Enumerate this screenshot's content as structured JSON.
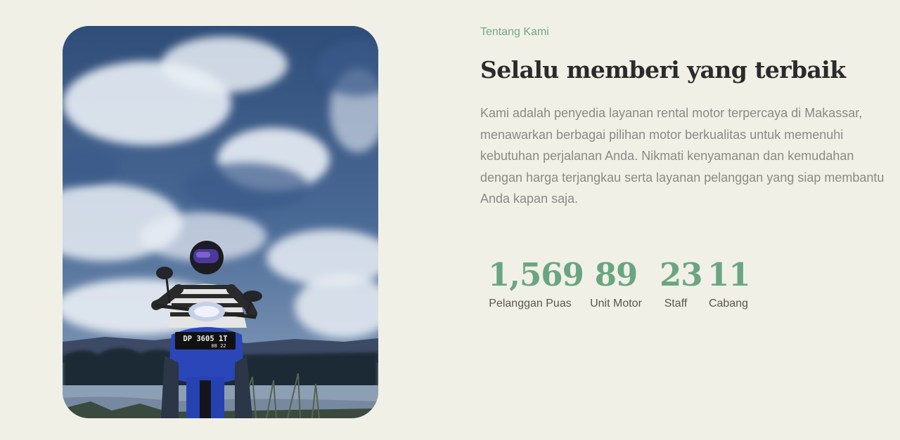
{
  "about": {
    "eyebrow": "Tentang Kami",
    "title": "Selalu memberi yang terbaik",
    "description": "Kami adalah penyedia layanan rental motor terpercaya di Makassar, menawarkan berbagai pilihan motor berkualitas untuk memenuhi kebutuhan perjalanan Anda. Nikmati kenyamanan dan kemudahan dengan harga terjangkau serta layanan pelanggan yang siap membantu Anda kapan saja."
  },
  "photo": {
    "plate_number": "DP 3605 1T",
    "plate_date": "08 22"
  },
  "stats": [
    {
      "value": "1,569",
      "label": "Pelanggan Puas"
    },
    {
      "value": "89",
      "label": "Unit Motor"
    },
    {
      "value": "23",
      "label": "Staff"
    },
    {
      "value": "11",
      "label": "Cabang"
    }
  ],
  "colors": {
    "background": "#f1f0e6",
    "accent_green": "#6aa582",
    "heading": "#2b2b2b",
    "body_text": "#8a8a87"
  }
}
